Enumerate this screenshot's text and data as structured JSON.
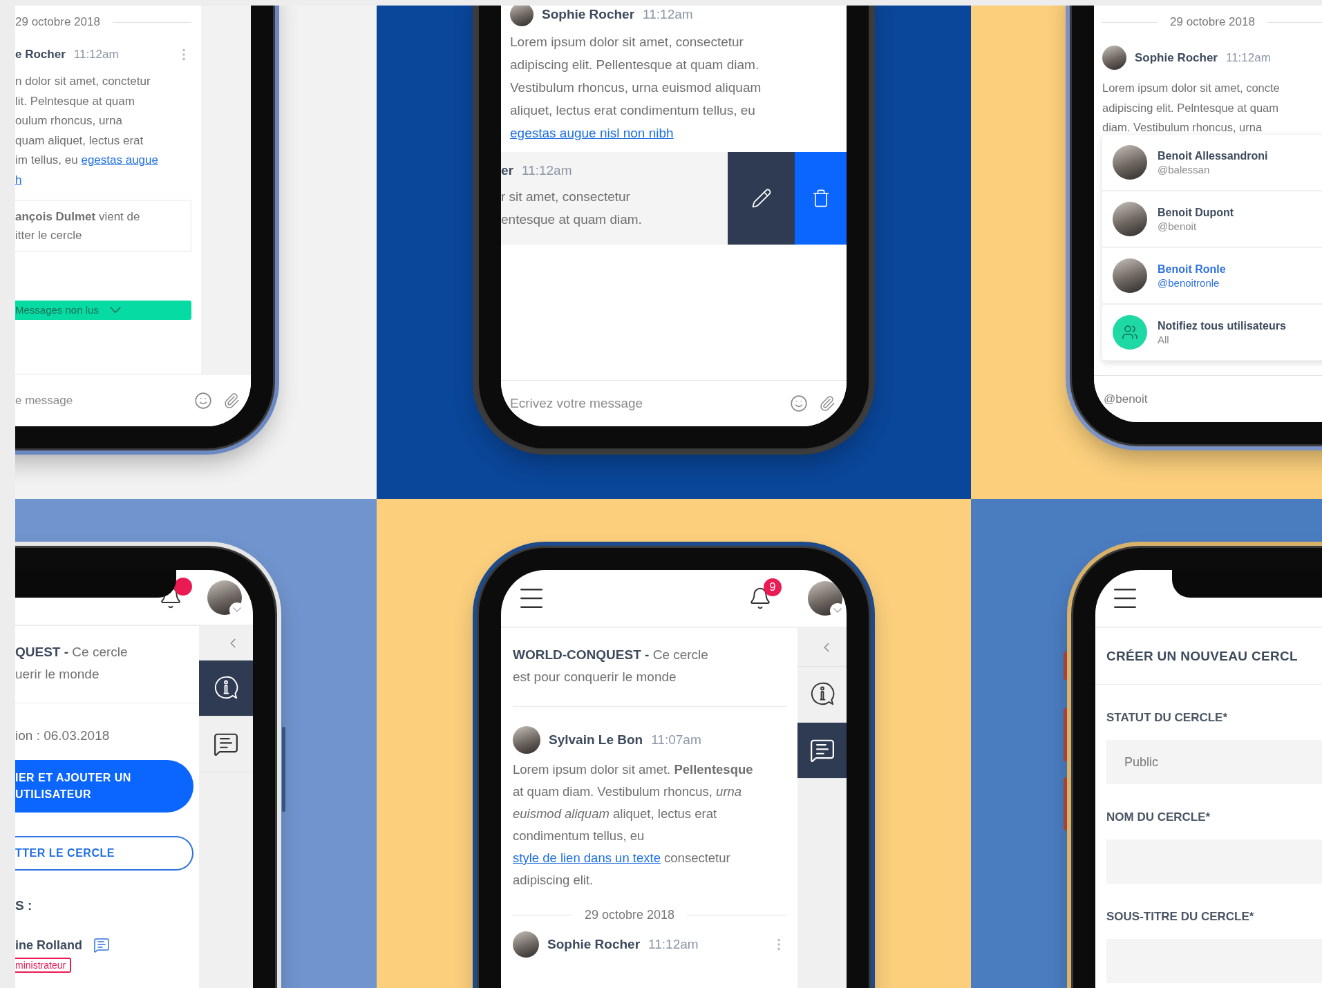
{
  "chat_unread": {
    "date": "29 octobre 2018",
    "message": {
      "author": "e Rocher",
      "time": "11:12am",
      "lines": [
        {
          "text": "n dolor sit amet, conctetur"
        },
        {
          "text": "lit. Pelntesque at quam"
        },
        {
          "text": "oulum rhoncus, urna"
        },
        {
          "text": "quam aliquet, lectus erat"
        },
        {
          "text": "im tellus, eu ",
          "link": "egestas augue"
        },
        {
          "link": "h"
        }
      ]
    },
    "notice": [
      "**ançois Dulmet** vient de",
      "itter le cercle"
    ],
    "unread_bar": "Messages non lus",
    "composer": {
      "placeholder": "e message"
    }
  },
  "chat_swipe": {
    "message": {
      "author": "Sophie Rocher",
      "time": "11:12am",
      "lines": [
        {
          "text": "Lorem ipsum dolor sit amet, consectetur"
        },
        {
          "text": "adipiscing elit. Pellentesque at quam diam."
        },
        {
          "text": "Vestibulum rhoncus, urna euismod aliquam"
        },
        {
          "text": "aliquet, lectus erat condimentum tellus, eu"
        },
        {
          "link": "egestas augue nisl non nibh"
        }
      ]
    },
    "swiped": {
      "author": "er",
      "time": "11:12am",
      "lines": [
        {
          "text": "r sit amet, consectetur"
        },
        {
          "text": "entesque at quam diam."
        }
      ],
      "actions": [
        {
          "kind": "edit"
        },
        {
          "kind": "delete"
        }
      ]
    },
    "composer": {
      "placeholder": "Ecrivez votre message"
    }
  },
  "chat_mention": {
    "date": "29 octobre 2018",
    "message": {
      "author": "Sophie Rocher",
      "time": "11:12am",
      "lines": [
        {
          "text": "Lorem ipsum dolor sit amet, concte"
        },
        {
          "text": "adipiscing elit. Pelntesque at quam"
        },
        {
          "text": "diam. Vestibulum rhoncus, urna"
        }
      ]
    },
    "suggestions": [
      {
        "kind": "user",
        "name": "Benoit Allessandroni",
        "handle": "@balessan",
        "selected": false
      },
      {
        "kind": "user",
        "name": "Benoit Dupont",
        "handle": "@benoit",
        "selected": false
      },
      {
        "kind": "user",
        "name": "Benoit Ronle",
        "handle": "@benoitronle",
        "selected": true
      },
      {
        "kind": "all",
        "name": "Notifiez tous utilisateurs",
        "handle": "All",
        "selected": false
      }
    ],
    "composer": {
      "value": "@benoit"
    }
  },
  "circle_info": {
    "title": [
      "**QUEST -** Ce cercle",
      "uerir le monde"
    ],
    "created": "ion : 06.03.2018",
    "buttons": [
      {
        "kind": "primary",
        "lines": [
          "IER ET AJOUTER UN",
          "UTILISATEUR"
        ]
      },
      {
        "kind": "outline",
        "lines": [
          "TTER LE CERCLE"
        ]
      }
    ],
    "members_heading": "S :",
    "members": [
      {
        "name": "ine Rolland",
        "role": "ministrateur"
      }
    ],
    "sidebar": [
      {
        "kind": "info",
        "selected": true
      },
      {
        "kind": "chat",
        "selected": false
      }
    ]
  },
  "circle_chat": {
    "badge": "9",
    "title": [
      "**WORLD-CONQUEST -** Ce cercle",
      "est pour conquerir le monde"
    ],
    "sidebar": [
      {
        "kind": "info",
        "selected": false
      },
      {
        "kind": "chat",
        "selected": true
      }
    ],
    "message": {
      "author": "Sylvain Le Bon",
      "time": "11:07am",
      "parts": [
        {
          "text": "Lorem ipsum dolor sit amet. **Pellentesque** at quam diam. Vestibulum rhoncus, *urna euismod aliquam* aliquet, lectus erat condimentum tellus, eu "
        },
        {
          "link": "style de lien dans un texte"
        },
        {
          "text": " consectetur adipiscing elit."
        }
      ]
    },
    "date": "29 octobre 2018",
    "next_message": {
      "author": "Sophie Rocher",
      "time": "11:12am"
    }
  },
  "circle_create": {
    "title": "CRÉER UN NOUVEAU CERCL",
    "fields": [
      {
        "kind": "select",
        "label": "STATUT DU CERCLE*",
        "value": "Public"
      },
      {
        "kind": "text",
        "label": "NOM DU CERCLE*"
      },
      {
        "kind": "text",
        "label": "SOUS-TITRE DU CERCLE*"
      }
    ]
  }
}
